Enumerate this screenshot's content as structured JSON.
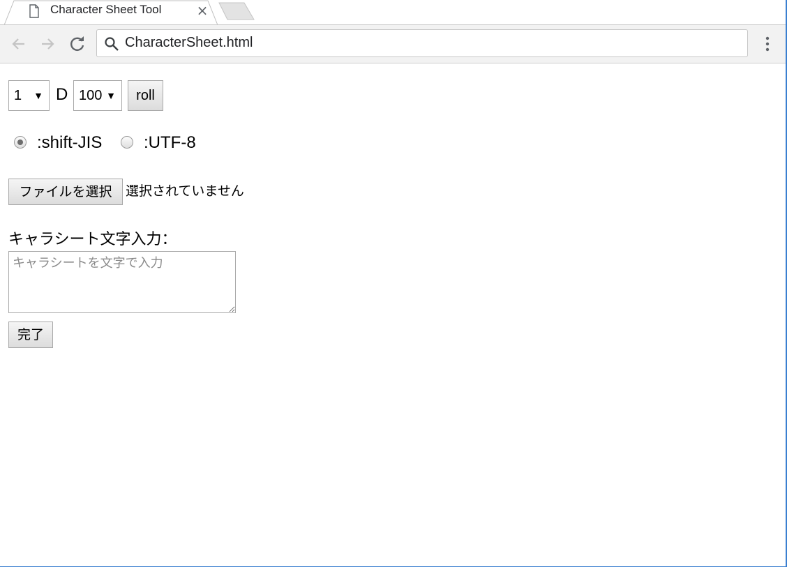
{
  "browser": {
    "tab_title": "Character Sheet Tool",
    "tab_close": "×",
    "url": "CharacterSheet.html"
  },
  "dice": {
    "count_value": "1",
    "separator": "D",
    "sides_value": "100",
    "dropdown_arrow": "▼",
    "roll_label": "roll"
  },
  "encoding": {
    "options": [
      {
        "label": ":shift-JIS",
        "checked": true
      },
      {
        "label": ":UTF-8",
        "checked": false
      }
    ]
  },
  "file_input": {
    "button_label": "ファイルを選択",
    "status": "選択されていません"
  },
  "char_sheet": {
    "label": "キャラシート文字入力：",
    "placeholder": "キャラシートを文字で入力",
    "value": "",
    "done_label": "完了"
  }
}
